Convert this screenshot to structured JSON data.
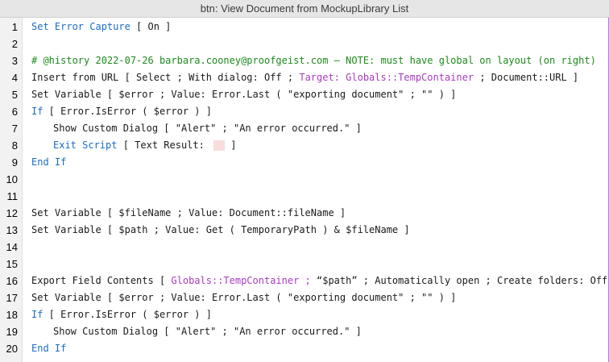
{
  "window": {
    "title": "btn: View Document from MockupLibrary List"
  },
  "lines": [
    {
      "num": "1",
      "parts": [
        {
          "t": "Set Error Capture",
          "c": "kw"
        },
        {
          "t": " [ On ]"
        }
      ]
    },
    {
      "num": "2",
      "parts": []
    },
    {
      "num": "3",
      "parts": [
        {
          "t": "# @history 2022-07-26 barbara.cooney@proofgeist.com – NOTE: must have global on layout (on right)",
          "c": "cmt"
        }
      ]
    },
    {
      "num": "4",
      "parts": [
        {
          "t": "Insert from URL [ Select ; With dialog: Off ; "
        },
        {
          "t": "Target: Globals::TempContainer",
          "c": "ref"
        },
        {
          "t": " ; Document::URL ]"
        }
      ]
    },
    {
      "num": "5",
      "parts": [
        {
          "t": "Set Variable [ $error ; Value: Error.Last ( \"exporting document\" ; \"\" ) ]"
        }
      ]
    },
    {
      "num": "6",
      "parts": [
        {
          "t": "If",
          "c": "kw"
        },
        {
          "t": " [ Error.IsError ( $error ) ]"
        }
      ]
    },
    {
      "num": "7",
      "indent": 1,
      "parts": [
        {
          "t": "Show Custom Dialog [ \"Alert\" ; \"An error occurred.\" ]"
        }
      ]
    },
    {
      "num": "8",
      "indent": 1,
      "parts": [
        {
          "t": "Exit Script",
          "c": "kw"
        },
        {
          "t": " [ Text Result: "
        },
        {
          "t": "",
          "c": "empty"
        },
        {
          "t": " ]"
        }
      ]
    },
    {
      "num": "9",
      "parts": [
        {
          "t": "End If",
          "c": "kw"
        }
      ]
    },
    {
      "num": "10",
      "parts": []
    },
    {
      "num": "11",
      "parts": []
    },
    {
      "num": "12",
      "parts": [
        {
          "t": "Set Variable [ $fileName ; Value: Document::fileName ]"
        }
      ]
    },
    {
      "num": "13",
      "parts": [
        {
          "t": "Set Variable [ $path ; Value: Get ( TemporaryPath ) & $fileName ]"
        }
      ]
    },
    {
      "num": "14",
      "parts": []
    },
    {
      "num": "15",
      "parts": []
    },
    {
      "num": "16",
      "parts": [
        {
          "t": "Export Field Contents [ "
        },
        {
          "t": "Globals::TempContainer ;",
          "c": "ref"
        },
        {
          "t": " “$path” ; Automatically open ; Create folders: Off ]"
        }
      ]
    },
    {
      "num": "17",
      "parts": [
        {
          "t": "Set Variable [ $error ; Value: Error.Last ( \"exporting document\" ; \"\" ) ]"
        }
      ]
    },
    {
      "num": "18",
      "parts": [
        {
          "t": "If",
          "c": "kw"
        },
        {
          "t": " [ Error.IsError ( $error ) ]"
        }
      ]
    },
    {
      "num": "19",
      "indent": 1,
      "parts": [
        {
          "t": "Show Custom Dialog [ \"Alert\" ; \"An error occurred.\" ]"
        }
      ]
    },
    {
      "num": "20",
      "parts": [
        {
          "t": "End If",
          "c": "kw"
        }
      ]
    }
  ]
}
